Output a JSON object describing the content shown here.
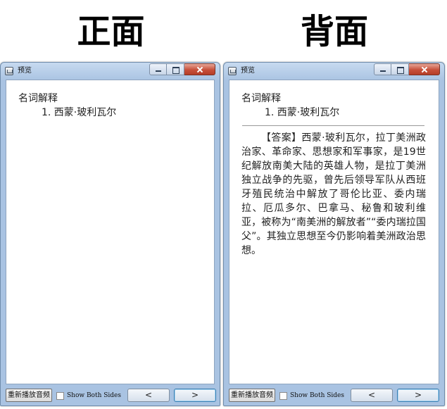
{
  "headings": {
    "front": "正面",
    "back": "背面"
  },
  "front_window": {
    "title": "预览",
    "card_type": "名词解释",
    "question": "1. 西蒙·玻利瓦尔",
    "replay_button": "重新播放音频",
    "show_both_sides": "Show Both Sides",
    "prev_button": "<",
    "next_button": ">"
  },
  "back_window": {
    "title": "预览",
    "card_type": "名词解释",
    "question": "1. 西蒙·玻利瓦尔",
    "answer": "【答案】西蒙·玻利瓦尔，拉丁美洲政治家、革命家、思想家和军事家，是19世纪解放南美大陆的英雄人物，是拉丁美洲独立战争的先驱，曾先后领导军队从西班牙殖民统治中解放了哥伦比亚、委内瑞拉、厄瓜多尔、巴拿马、秘鲁和玻利维亚，被称为“南美洲的解放者”“委内瑞拉国父”。其独立思想至今仍影响着美洲政治思想。",
    "replay_button": "重新播放音频",
    "show_both_sides": "Show Both Sides",
    "prev_button": "<",
    "next_button": ">"
  }
}
